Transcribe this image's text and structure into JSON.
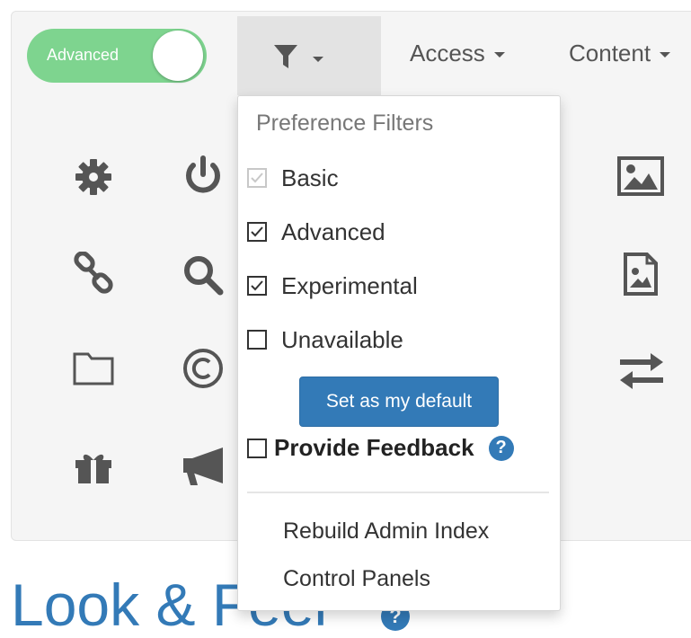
{
  "toggle": {
    "label": "Advanced",
    "state": "on",
    "color": "#7ed48f"
  },
  "nav": {
    "filter_icon": "filter-icon",
    "items": [
      {
        "label": "Access"
      },
      {
        "label": "Content"
      }
    ]
  },
  "grid_icons": [
    "gear-icon",
    "power-icon",
    "link-icon",
    "search-icon",
    "folder-icon",
    "copyright-icon",
    "gift-icon",
    "megaphone-icon",
    "image-icon",
    "image-file-icon",
    "exchange-icon"
  ],
  "dropdown": {
    "header": "Preference Filters",
    "filters": [
      {
        "label": "Basic",
        "checked": true,
        "disabled": true
      },
      {
        "label": "Advanced",
        "checked": true,
        "disabled": false
      },
      {
        "label": "Experimental",
        "checked": true,
        "disabled": false
      },
      {
        "label": "Unavailable",
        "checked": false,
        "disabled": false
      }
    ],
    "default_button": "Set as my default",
    "feedback_label": "Provide Feedback",
    "feedback_help": "?",
    "links": [
      {
        "label": "Rebuild Admin Index"
      },
      {
        "label": "Control Panels"
      }
    ]
  },
  "page": {
    "title": "Look & Feel",
    "help": "?"
  },
  "colors": {
    "accent": "#337ab7",
    "toggle_on": "#7ed48f",
    "panel_bg": "#f5f5f5"
  }
}
